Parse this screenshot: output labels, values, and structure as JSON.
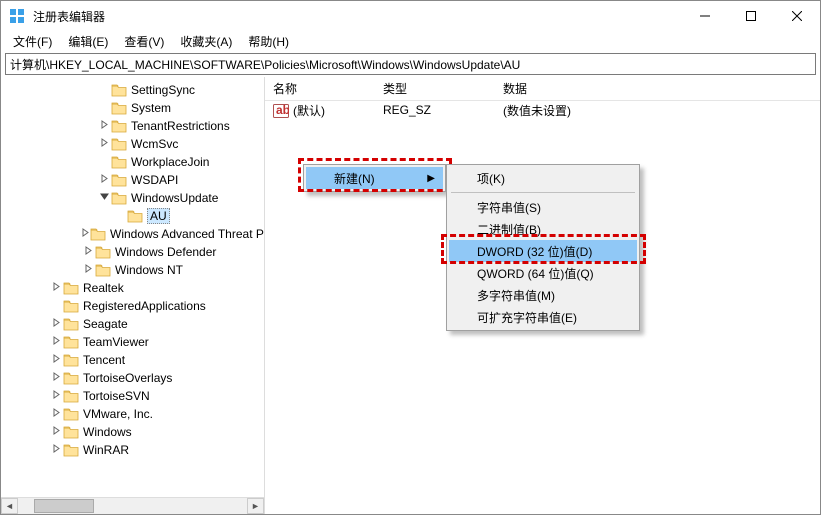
{
  "window": {
    "title": "注册表编辑器"
  },
  "menu": {
    "file": "文件(F)",
    "edit": "编辑(E)",
    "view": "查看(V)",
    "favorites": "收藏夹(A)",
    "help": "帮助(H)"
  },
  "address": {
    "path": "计算机\\HKEY_LOCAL_MACHINE\\SOFTWARE\\Policies\\Microsoft\\Windows\\WindowsUpdate\\AU"
  },
  "columns": {
    "name": "名称",
    "type": "类型",
    "data": "数据"
  },
  "default_value": {
    "name": "(默认)",
    "type": "REG_SZ",
    "data": "(数值未设置)"
  },
  "tree": [
    {
      "label": "SettingSync",
      "indent": 6,
      "exp": ""
    },
    {
      "label": "System",
      "indent": 6,
      "exp": ""
    },
    {
      "label": "TenantRestrictions",
      "indent": 6,
      "exp": ">"
    },
    {
      "label": "WcmSvc",
      "indent": 6,
      "exp": ">"
    },
    {
      "label": "WorkplaceJoin",
      "indent": 6,
      "exp": ""
    },
    {
      "label": "WSDAPI",
      "indent": 6,
      "exp": ">"
    },
    {
      "label": "WindowsUpdate",
      "indent": 6,
      "exp": "v"
    },
    {
      "label": "AU",
      "indent": 7,
      "exp": "",
      "selected": true
    },
    {
      "label": "Windows Advanced Threat Protection",
      "indent": 5,
      "exp": ">"
    },
    {
      "label": "Windows Defender",
      "indent": 5,
      "exp": ">"
    },
    {
      "label": "Windows NT",
      "indent": 5,
      "exp": ">"
    },
    {
      "label": "Realtek",
      "indent": 3,
      "exp": ">"
    },
    {
      "label": "RegisteredApplications",
      "indent": 3,
      "exp": ""
    },
    {
      "label": "Seagate",
      "indent": 3,
      "exp": ">"
    },
    {
      "label": "TeamViewer",
      "indent": 3,
      "exp": ">"
    },
    {
      "label": "Tencent",
      "indent": 3,
      "exp": ">"
    },
    {
      "label": "TortoiseOverlays",
      "indent": 3,
      "exp": ">"
    },
    {
      "label": "TortoiseSVN",
      "indent": 3,
      "exp": ">"
    },
    {
      "label": "VMware, Inc.",
      "indent": 3,
      "exp": ">"
    },
    {
      "label": "Windows",
      "indent": 3,
      "exp": ">"
    },
    {
      "label": "WinRAR",
      "indent": 3,
      "exp": ">"
    }
  ],
  "ctx_new": {
    "label": "新建(N)"
  },
  "ctx_sub": {
    "key": "项(K)",
    "string": "字符串值(S)",
    "binary": "二进制值(B)",
    "dword": "DWORD (32 位)值(D)",
    "qword": "QWORD (64 位)值(Q)",
    "multi": "多字符串值(M)",
    "expand": "可扩充字符串值(E)"
  }
}
